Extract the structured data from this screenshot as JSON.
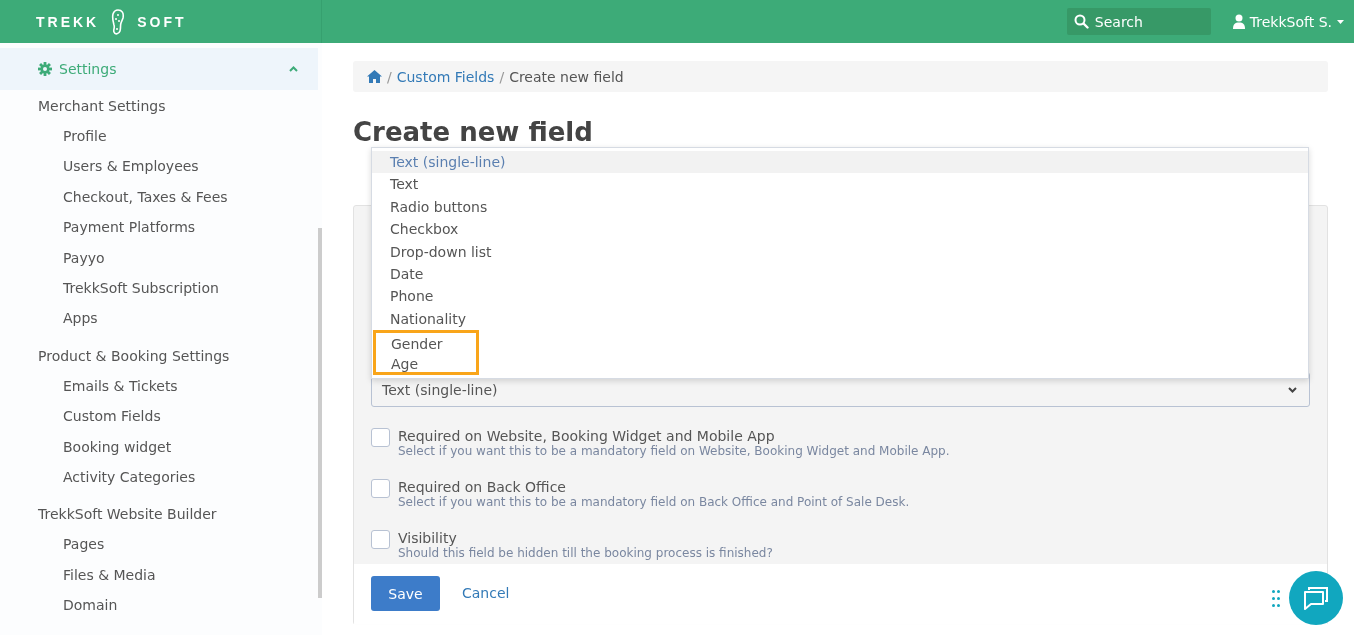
{
  "header": {
    "logo_left": "TREKK",
    "logo_right": "SOFT",
    "search": {
      "placeholder": "Search"
    },
    "user": "TrekkSoft S."
  },
  "sidebar": {
    "section": {
      "label": "Settings",
      "expanded": true
    },
    "groups": [
      {
        "label": "Merchant Settings",
        "children": [
          {
            "label": "Profile"
          },
          {
            "label": "Users & Employees"
          },
          {
            "label": "Checkout, Taxes & Fees"
          },
          {
            "label": "Payment Platforms"
          },
          {
            "label": "Payyo"
          },
          {
            "label": "TrekkSoft Subscription"
          },
          {
            "label": "Apps"
          }
        ]
      },
      {
        "label": "Product & Booking Settings",
        "children": [
          {
            "label": "Emails & Tickets"
          },
          {
            "label": "Custom Fields"
          },
          {
            "label": "Booking widget"
          },
          {
            "label": "Activity Categories"
          }
        ]
      },
      {
        "label": "TrekkSoft Website Builder",
        "children": [
          {
            "label": "Pages"
          },
          {
            "label": "Files & Media"
          },
          {
            "label": "Domain"
          }
        ]
      }
    ]
  },
  "breadcrumb": [
    {
      "separator": "/",
      "label": "Custom Fields",
      "link": true
    },
    {
      "separator": "/",
      "label": "Create new field",
      "link": false
    }
  ],
  "title": "Create new field",
  "dropdown": {
    "options": [
      {
        "label": "Text (single-line)",
        "selected": true,
        "highlighted": false
      },
      {
        "label": "Text",
        "selected": false,
        "highlighted": false
      },
      {
        "label": "Radio buttons",
        "selected": false,
        "highlighted": false
      },
      {
        "label": "Checkbox",
        "selected": false,
        "highlighted": false
      },
      {
        "label": "Drop-down list",
        "selected": false,
        "highlighted": false
      },
      {
        "label": "Date",
        "selected": false,
        "highlighted": false
      },
      {
        "label": "Phone",
        "selected": false,
        "highlighted": false
      },
      {
        "label": "Nationality",
        "selected": false,
        "highlighted": false
      },
      {
        "label": "Gender",
        "selected": false,
        "highlighted": true
      },
      {
        "label": "Age",
        "selected": false,
        "highlighted": true
      }
    ],
    "value": "Text (single-line)"
  },
  "checkboxes": [
    {
      "label": "Required on Website, Booking Widget and Mobile App",
      "help": "Select if you want this to be a mandatory field on Website, Booking Widget and Mobile App.",
      "checked": false
    },
    {
      "label": "Required on Back Office",
      "help": "Select if you want this to be a mandatory field on Back Office and Point of Sale Desk.",
      "checked": false
    },
    {
      "label": "Visibility",
      "help": "Should this field be hidden till the booking process is finished?",
      "checked": false
    }
  ],
  "buttons": [
    {
      "label": "Save",
      "kind": "primary"
    },
    {
      "label": "Cancel",
      "kind": "link"
    }
  ]
}
